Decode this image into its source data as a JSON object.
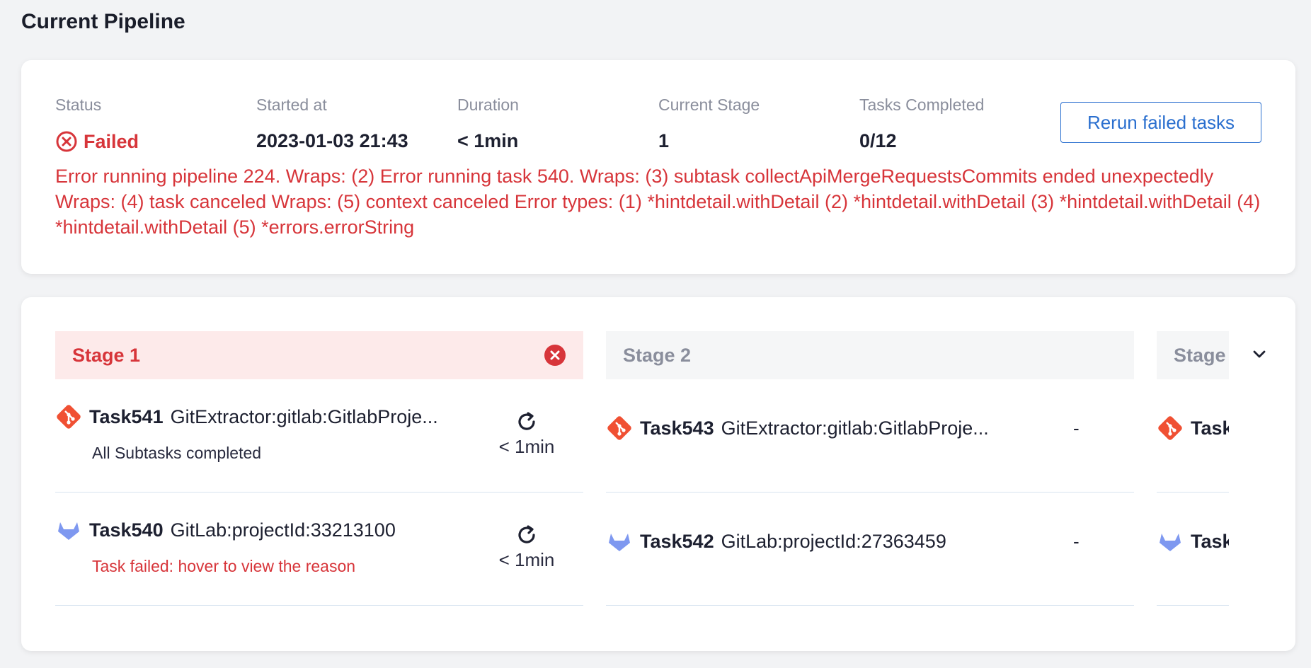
{
  "page": {
    "title": "Current Pipeline"
  },
  "summary": {
    "status_label": "Status",
    "status_value": "Failed",
    "started_label": "Started at",
    "started_value": "2023-01-03 21:43",
    "duration_label": "Duration",
    "duration_value": "< 1min",
    "stage_label": "Current Stage",
    "stage_value": "1",
    "tasks_label": "Tasks Completed",
    "tasks_value": "0/12",
    "rerun_button": "Rerun failed tasks",
    "error_message": "Error running pipeline 224. Wraps: (2) Error running task 540. Wraps: (3) subtask collectApiMergeRequestsCommits ended unexpectedly Wraps: (4) task canceled Wraps: (5) context canceled Error types: (1) *hintdetail.withDetail (2) *hintdetail.withDetail (3) *hintdetail.withDetail (4) *hintdetail.withDetail (5) *errors.errorString"
  },
  "stages": [
    {
      "title": "Stage 1",
      "state": "failed",
      "tasks": [
        {
          "id": "Task541",
          "name": "GitExtractor:gitlab:GitlabProje...",
          "icon": "git-icon",
          "sub": "All Subtasks completed",
          "time": "< 1min"
        },
        {
          "id": "Task540",
          "name": "GitLab:projectId:33213100",
          "icon": "gitlab-icon",
          "sub": "Task failed: hover to view the reason",
          "time": "< 1min"
        }
      ]
    },
    {
      "title": "Stage 2",
      "state": "pending",
      "tasks": [
        {
          "id": "Task543",
          "name": "GitExtractor:gitlab:GitlabProje...",
          "icon": "git-icon",
          "dash": "-"
        },
        {
          "id": "Task542",
          "name": "GitLab:projectId:27363459",
          "icon": "gitlab-icon",
          "dash": "-"
        }
      ]
    },
    {
      "title": "Stage",
      "state": "pending",
      "tasks": [
        {
          "id": "Task",
          "icon": "git-icon"
        },
        {
          "id": "Task",
          "icon": "gitlab-icon"
        }
      ]
    }
  ],
  "colors": {
    "error": "#d7353a",
    "primary": "#2a6fcf",
    "git": "#f05033",
    "gitlab": "#7e98f0"
  }
}
